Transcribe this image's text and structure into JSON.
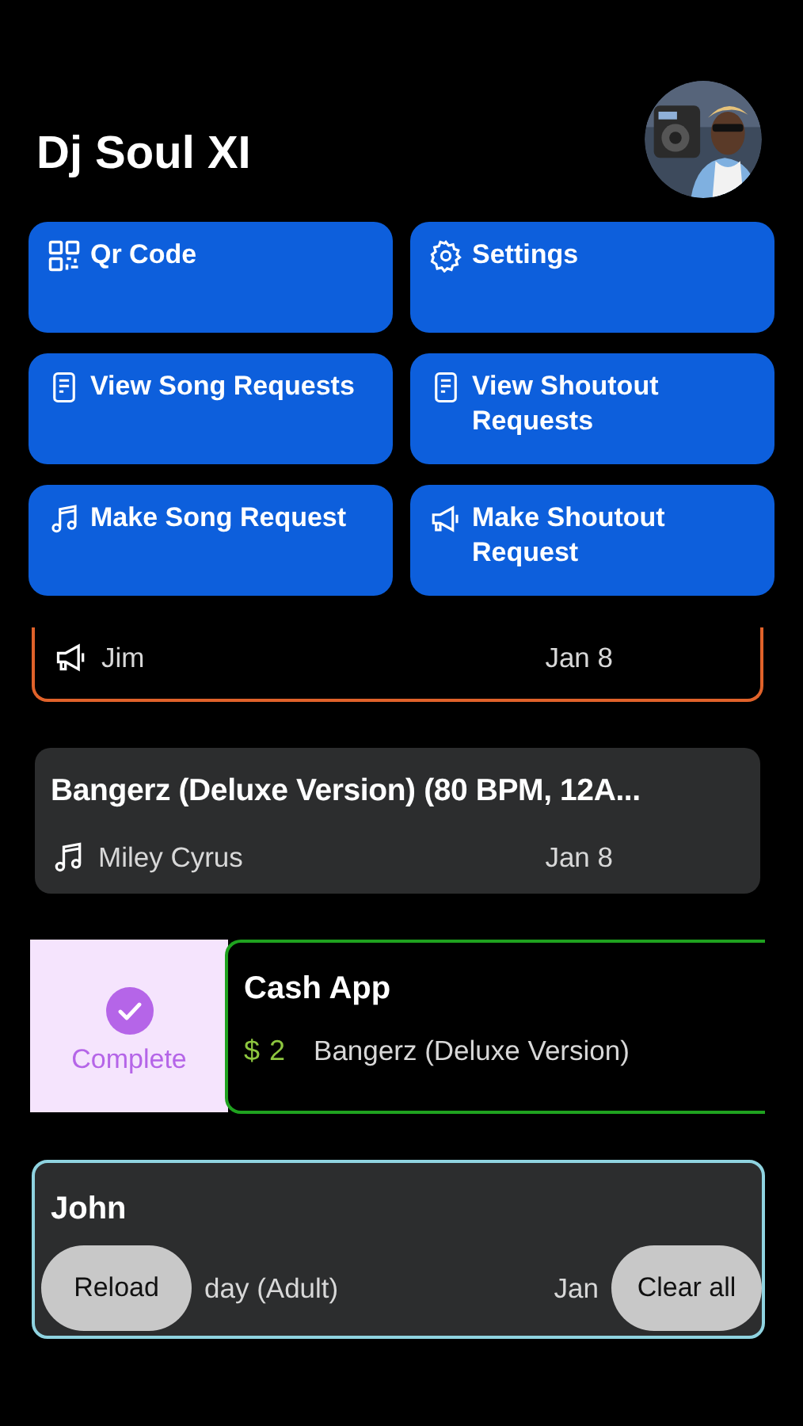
{
  "header": {
    "title": "Dj Soul XI"
  },
  "actions": [
    {
      "label": "Qr Code",
      "kind": "qr"
    },
    {
      "label": "Settings",
      "kind": "settings"
    },
    {
      "label": "View Song Requests",
      "kind": "document"
    },
    {
      "label": "View Shoutout Requests",
      "kind": "document"
    },
    {
      "label": "Make Song Request",
      "kind": "music"
    },
    {
      "label": "Make Shoutout Request",
      "kind": "megaphone"
    }
  ],
  "requests": [
    {
      "kind": "shoutout",
      "name": "Jim",
      "date": "Jan 8",
      "color": "#e0622a"
    },
    {
      "kind": "song",
      "title": "Bangerz (Deluxe Version) (80 BPM, 12A...",
      "artist": "Miley Cyrus",
      "date": "Jan 8"
    },
    {
      "kind": "payment",
      "title": "Cash App",
      "currency": "$",
      "amount": "2",
      "song": "Bangerz (Deluxe Version)",
      "color": "#1fa21f",
      "swipe_action": "Complete"
    },
    {
      "kind": "event",
      "title": "John",
      "subtitle": "day (Adult)",
      "date": "Jan",
      "color": "#8fd3e0"
    }
  ],
  "floating": {
    "reload": "Reload",
    "clear": "Clear all"
  }
}
